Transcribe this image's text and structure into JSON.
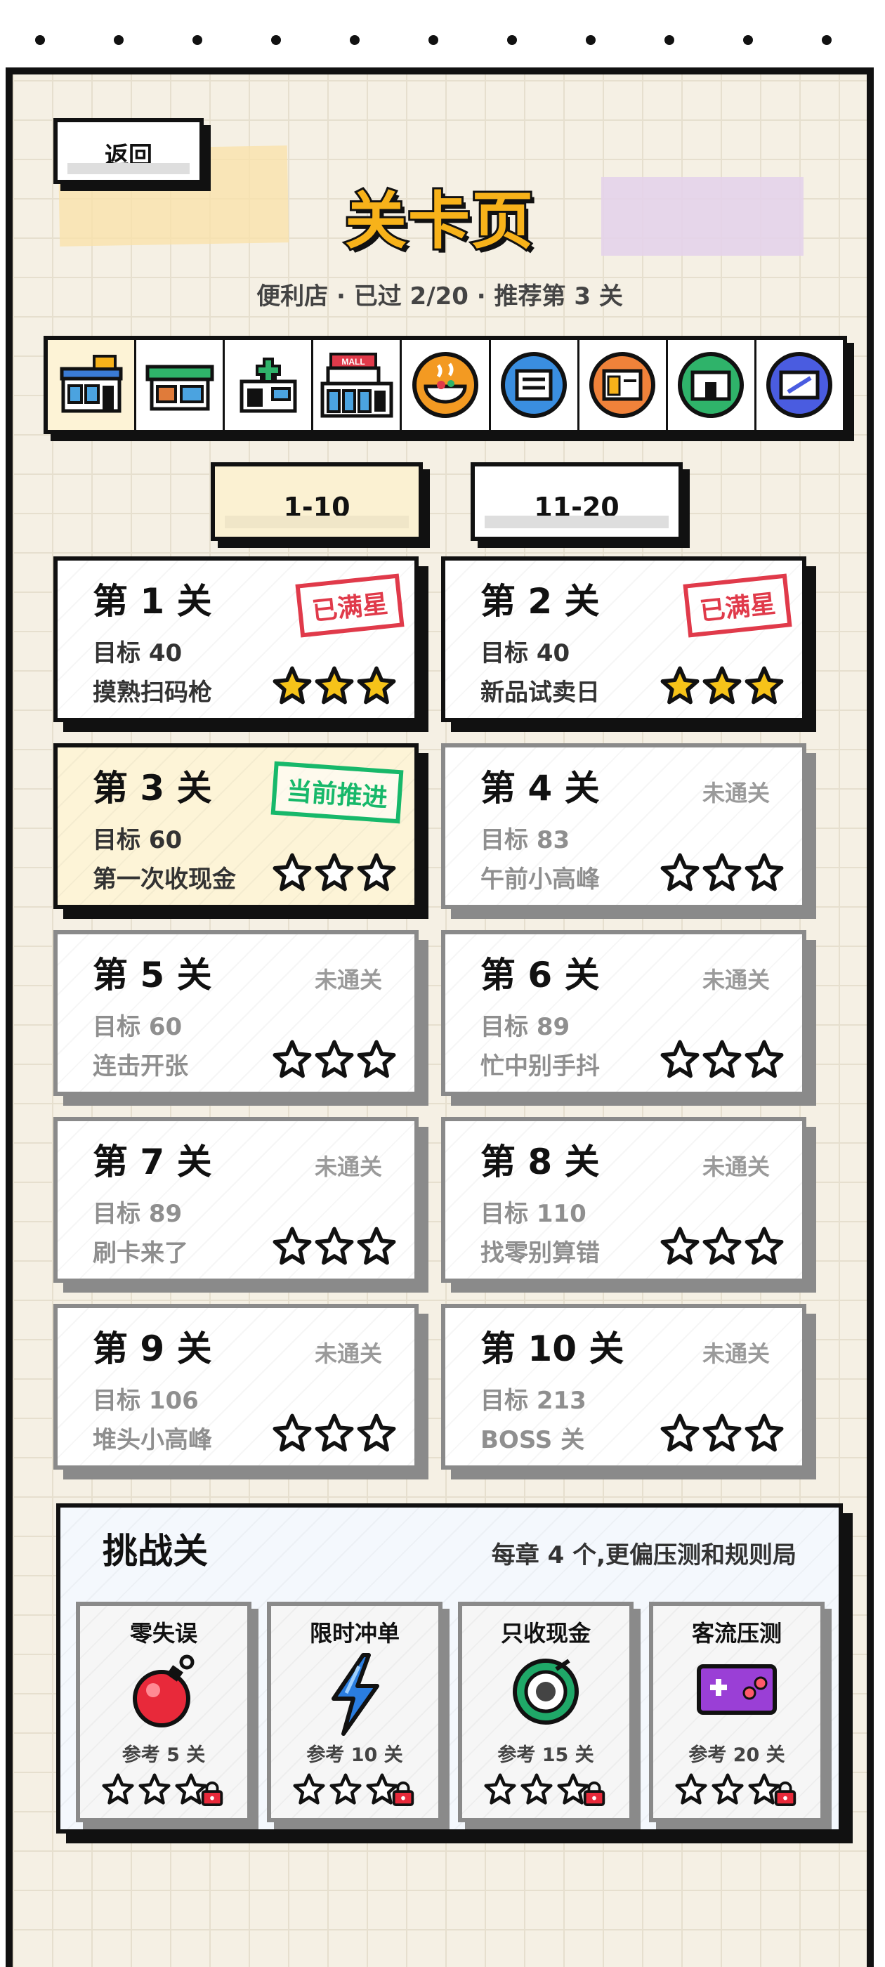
{
  "header": {
    "back_label": "返回",
    "title": "关卡页",
    "subtitle": "便利店 · 已过 2/20 · 推荐第 3 关"
  },
  "chapters": [
    {
      "icon": "convenience-store-icon",
      "active": true
    },
    {
      "icon": "market-stall-icon"
    },
    {
      "icon": "pharmacy-icon"
    },
    {
      "icon": "mall-icon"
    },
    {
      "icon": "food-bowl-icon"
    },
    {
      "icon": "book-icon"
    },
    {
      "icon": "shop-window-icon"
    },
    {
      "icon": "green-store-icon"
    },
    {
      "icon": "ticket-icon"
    }
  ],
  "range_tabs": [
    {
      "label": "1-10",
      "selected": true
    },
    {
      "label": "11-20",
      "selected": false
    }
  ],
  "levels": [
    {
      "title": "第 1 关",
      "target": "目标 40",
      "name": "摸熟扫码枪",
      "status": "已满星",
      "stars": 3
    },
    {
      "title": "第 2 关",
      "target": "目标 40",
      "name": "新品试卖日",
      "status": "已满星",
      "stars": 3
    },
    {
      "title": "第 3 关",
      "target": "目标 60",
      "name": "第一次收现金",
      "status": "当前推进",
      "stars": 0
    },
    {
      "title": "第 4 关",
      "target": "目标 83",
      "name": "午前小高峰",
      "status": "未通关",
      "stars": 0
    },
    {
      "title": "第 5 关",
      "target": "目标 60",
      "name": "连击开张",
      "status": "未通关",
      "stars": 0
    },
    {
      "title": "第 6 关",
      "target": "目标 89",
      "name": "忙中别手抖",
      "status": "未通关",
      "stars": 0
    },
    {
      "title": "第 7 关",
      "target": "目标 89",
      "name": "刷卡来了",
      "status": "未通关",
      "stars": 0
    },
    {
      "title": "第 8 关",
      "target": "目标 110",
      "name": "找零别算错",
      "status": "未通关",
      "stars": 0
    },
    {
      "title": "第 9 关",
      "target": "目标 106",
      "name": "堆头小高峰",
      "status": "未通关",
      "stars": 0
    },
    {
      "title": "第 10 关",
      "target": "目标 213",
      "name": "BOSS 关",
      "status": "未通关",
      "stars": 0
    }
  ],
  "challenge": {
    "title": "挑战关",
    "description": "每章 4 个,更偏压测和规则局",
    "cards": [
      {
        "name": "零失误",
        "ref": "参考 5 关",
        "icon": "bomb-icon"
      },
      {
        "name": "限时冲单",
        "ref": "参考 10 关",
        "icon": "lightning-icon"
      },
      {
        "name": "只收现金",
        "ref": "参考 15 关",
        "icon": "coin-target-icon"
      },
      {
        "name": "客流压测",
        "ref": "参考 20 关",
        "icon": "gamepad-icon"
      }
    ]
  },
  "colors": {
    "accent": "#f7b21a",
    "background": "#f5f0e4",
    "star_gold": "#f6c319",
    "stamp_red": "#e03a4a",
    "stamp_green": "#17b86a"
  }
}
